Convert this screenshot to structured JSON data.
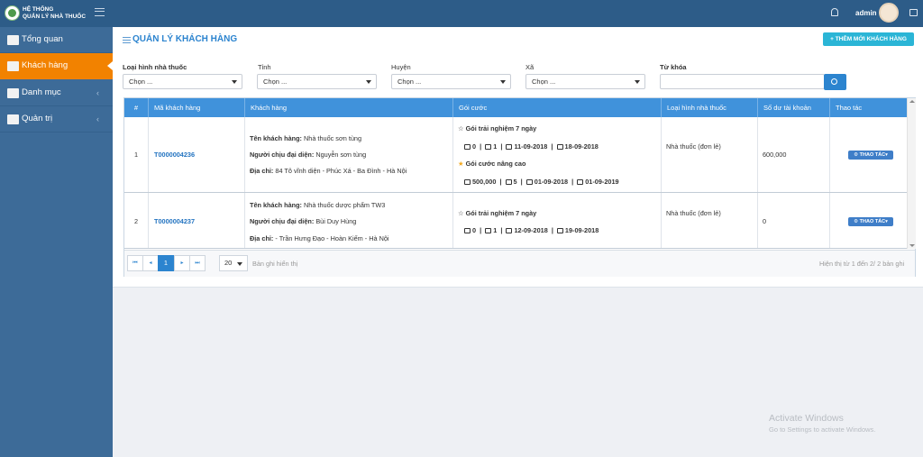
{
  "app": {
    "brand_line1": "HỆ THỐNG",
    "brand_line2": "QUẢN LÝ NHÀ THUỐC",
    "user": "admin",
    "icons": [
      "menu-icon",
      "bell-icon",
      "chat-icon"
    ]
  },
  "sidebar": {
    "items": [
      {
        "label": "Tổng quan",
        "icon": "book-icon"
      },
      {
        "label": "Khách hàng",
        "icon": "user-icon"
      },
      {
        "label": "Danh mục",
        "icon": "list-icon"
      },
      {
        "label": "Quản trị",
        "icon": "monitor-icon"
      }
    ]
  },
  "page": {
    "title": "QUẢN LÝ KHÁCH HÀNG",
    "add_button": "+ THÊM MỚI KHÁCH HÀNG"
  },
  "filters": {
    "type_label": "Loại hình nhà thuốc",
    "province_label": "Tỉnh",
    "district_label": "Huyện",
    "ward_label": "Xã",
    "keyword_label": "Từ khóa",
    "select_value": "Chọn ...",
    "keyword_value": ""
  },
  "table": {
    "headers": [
      "#",
      "Mã khách hàng",
      "Khách hàng",
      "Gói cước",
      "Loại hình nhà thuốc",
      "Số dư tài khoản",
      "Thao tác"
    ],
    "field_labels": {
      "name": "Tên khách hàng:",
      "representative": "Người chịu đại diện:",
      "address": "Địa chỉ:"
    },
    "rows": [
      {
        "index": "1",
        "code": "T0000004236",
        "name": "Nhà thuốc sơn tùng",
        "representative": "Nguyễn sơn tùng",
        "address": "84 Tô vĩnh diện - Phúc Xá - Ba Đình - Hà Nội",
        "package1_name": "Gói trải nghiệm 7 ngày",
        "package1_fee": "0",
        "package1_users": "1",
        "package1_start": "11-09-2018",
        "package1_end": "18-09-2018",
        "package2_name": "Gói cước nâng cao",
        "package2_fee": "500,000",
        "package2_users": "5",
        "package2_start": "01-09-2018",
        "package2_end": "01-09-2019",
        "type": "Nhà thuốc (đơn lẻ)",
        "balance": "600,000",
        "action": "THAO TÁC"
      },
      {
        "index": "2",
        "code": "T0000004237",
        "name": "Nhà thuốc dược phẩm TW3",
        "representative": "Bùi Duy Hùng",
        "address": "- Trần Hưng Đạo - Hoàn Kiếm - Hà Nội",
        "package1_name": "Gói trải nghiệm 7 ngày",
        "package1_fee": "0",
        "package1_users": "1",
        "package1_start": "12-09-2018",
        "package1_end": "19-09-2018",
        "type": "Nhà thuốc (đơn lẻ)",
        "balance": "0",
        "action": "THAO TÁC"
      }
    ]
  },
  "pagination": {
    "current_page": "1",
    "page_size": "20",
    "page_size_label": "Bản ghi hiển thị",
    "summary": "Hiện thị từ 1 đến 2/ 2 bản ghi"
  },
  "watermark": {
    "title": "Activate Windows",
    "subtitle": "Go to Settings to activate Windows."
  },
  "colors": {
    "sidebar": "#3d6b98",
    "active": "#f28200",
    "header": "#4092db",
    "accent": "#2c84cf",
    "add_button": "#2bb5d6"
  }
}
